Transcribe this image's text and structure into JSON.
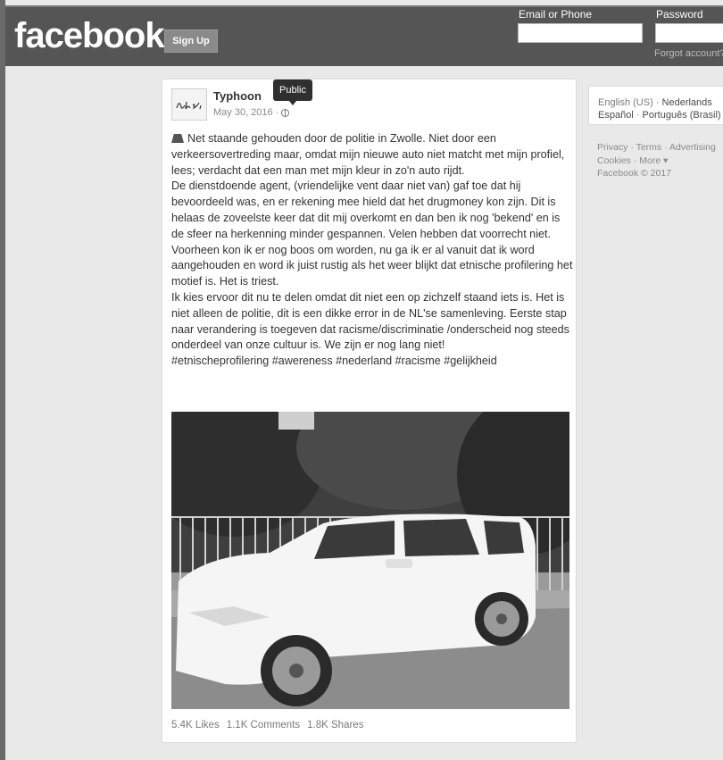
{
  "header": {
    "logo": "facebook",
    "signup_label": "Sign Up",
    "email_label": "Email or Phone",
    "password_label": "Password",
    "forgot_label": "Forgot account?"
  },
  "post": {
    "author": "Typhoon",
    "date": "May 30, 2016 ·",
    "tooltip": "Public",
    "lines": [
      "Net staande gehouden door de politie in Zwolle. Niet door een verkeersovertreding maar, omdat mijn nieuwe auto niet matcht met mijn profiel, lees; verdacht dat een man met mijn kleur in zo'n auto rijdt.",
      "De dienstdoende agent, (vriendelijke vent daar niet van) gaf toe dat hij bevoordeeld was, en er rekening mee hield dat het drugmoney kon zijn. Dit is helaas de zoveelste keer dat dit mij overkomt en dan ben ik nog 'bekend' en is de sfeer na herkenning minder gespannen. Velen hebben dat voorrecht niet.",
      "Voorheen kon ik er nog boos om worden, nu ga ik er al vanuit dat ik word aangehouden en word ik juist rustig als het weer blijkt dat etnische profilering het motief is. Het is triest.",
      "Ik kies ervoor dit nu te delen omdat dit niet een op zichzelf staand iets is. Het is niet alleen de politie, dit is een dikke error in de NL'se samenleving. Eerste stap naar verandering is toegeven dat racisme/discriminatie /onderscheid nog steeds onderdeel van onze cultuur is. We zijn er nog lang niet!",
      "#etnischeprofilering #awereness #nederland #racisme #gelijkheid"
    ],
    "likes": "5.4K Likes",
    "comments": "1.1K Comments",
    "shares": "1.8K Shares"
  },
  "sidebar": {
    "lang_current": "English (US)",
    "lang_sep": " · ",
    "lang_nl": "Nederlands",
    "lang_es": "Español",
    "lang_pt": "Português (Brasil)",
    "privacy": "Privacy",
    "terms": "Terms",
    "advertising": "Advertising",
    "cookies": "Cookies",
    "more": "More",
    "copyright": "Facebook © 2017"
  }
}
